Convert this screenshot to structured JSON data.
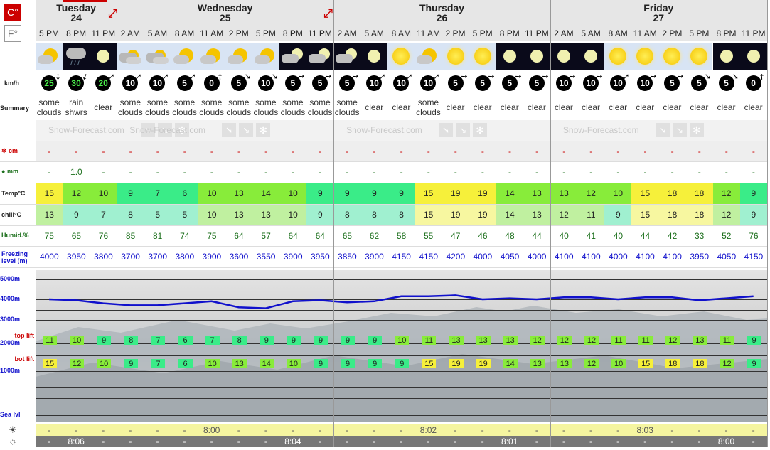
{
  "units": {
    "temp": "C°",
    "fahrenheit": "F°"
  },
  "days": [
    {
      "name": "Tuesday",
      "date": "24"
    },
    {
      "name": "Wednesday",
      "date": "25"
    },
    {
      "name": "Thursday",
      "date": "26"
    },
    {
      "name": "Friday",
      "date": "27"
    }
  ],
  "times": [
    "5 PM",
    "8 PM",
    "11 PM",
    "2 AM",
    "5 AM",
    "8 AM",
    "11 AM",
    "2 PM",
    "5 PM",
    "8 PM",
    "11 PM",
    "2 AM",
    "5 AM",
    "8 AM",
    "11 AM",
    "2 PM",
    "5 PM",
    "8 PM",
    "11 PM",
    "2 AM",
    "5 AM",
    "8 AM",
    "11 AM",
    "2 PM",
    "5 PM",
    "8 PM",
    "11 PM"
  ],
  "weather_icons": [
    "partly-cloudy-icon",
    "night-rain-icon",
    "night-clear-icon",
    "cloudy-icon",
    "cloudy-icon",
    "partly-cloudy-icon",
    "partly-cloudy-icon",
    "partly-cloudy-icon",
    "partly-cloudy-icon",
    "night-cloudy-icon",
    "night-cloudy-icon",
    "night-cloudy-icon",
    "night-clear-icon",
    "sun-icon",
    "partly-cloudy-icon",
    "sun-icon",
    "sun-icon",
    "night-clear-icon",
    "night-clear-icon",
    "night-clear-icon",
    "night-clear-icon",
    "sun-icon",
    "sun-icon",
    "sun-icon",
    "sun-icon",
    "night-clear-icon",
    "night-clear-icon"
  ],
  "wind_label": "km/h",
  "wind": [
    25,
    30,
    20,
    10,
    10,
    5,
    0,
    5,
    10,
    5,
    5,
    5,
    10,
    10,
    10,
    5,
    5,
    5,
    5,
    10,
    10,
    10,
    10,
    5,
    5,
    5,
    0
  ],
  "wind_dir": [
    180,
    200,
    45,
    45,
    45,
    45,
    0,
    135,
    135,
    90,
    90,
    90,
    45,
    45,
    45,
    90,
    90,
    90,
    90,
    90,
    90,
    45,
    90,
    90,
    135,
    135,
    0
  ],
  "summary_label": "Summary",
  "summary": [
    "some clouds",
    "rain shwrs",
    "clear",
    "some clouds",
    "some clouds",
    "some clouds",
    "some clouds",
    "some clouds",
    "some clouds",
    "some clouds",
    "some clouds",
    "some clouds",
    "clear",
    "clear",
    "some clouds",
    "clear",
    "clear",
    "clear",
    "clear",
    "clear",
    "clear",
    "clear",
    "clear",
    "clear",
    "clear",
    "clear",
    "clear"
  ],
  "brand": "Snow-Forecast.com",
  "snow_label": "cm",
  "snow": [
    "-",
    "-",
    "-",
    "-",
    "-",
    "-",
    "-",
    "-",
    "-",
    "-",
    "-",
    "-",
    "-",
    "-",
    "-",
    "-",
    "-",
    "-",
    "-",
    "-",
    "-",
    "-",
    "-",
    "-",
    "-",
    "-",
    "-"
  ],
  "rain_label": "mm",
  "rain": [
    "-",
    "1.0",
    "-",
    "-",
    "-",
    "-",
    "-",
    "-",
    "-",
    "-",
    "-",
    "-",
    "-",
    "-",
    "-",
    "-",
    "-",
    "-",
    "-",
    "-",
    "-",
    "-",
    "-",
    "-",
    "-",
    "-",
    "-"
  ],
  "temp_label": "Temp°C",
  "temp": [
    15,
    12,
    10,
    9,
    7,
    6,
    10,
    13,
    14,
    10,
    9,
    9,
    9,
    9,
    15,
    19,
    19,
    14,
    13,
    13,
    12,
    10,
    15,
    18,
    18,
    12,
    9
  ],
  "chill_label": "chill°C",
  "chill": [
    13,
    9,
    7,
    8,
    5,
    5,
    10,
    13,
    13,
    10,
    9,
    8,
    8,
    8,
    15,
    19,
    19,
    14,
    13,
    12,
    11,
    9,
    15,
    18,
    18,
    12,
    9
  ],
  "humid_label": "Humid.%",
  "humid": [
    75,
    65,
    76,
    85,
    81,
    74,
    75,
    64,
    57,
    64,
    64,
    65,
    62,
    58,
    55,
    47,
    46,
    48,
    44,
    40,
    41,
    40,
    44,
    42,
    33,
    52,
    76
  ],
  "freeze_label": "Freezing level (m)",
  "freeze": [
    4000,
    3950,
    3800,
    3700,
    3700,
    3800,
    3900,
    3600,
    3550,
    3900,
    3950,
    3850,
    3900,
    4150,
    4150,
    4200,
    4000,
    4050,
    4000,
    4100,
    4100,
    4000,
    4100,
    4100,
    3950,
    4050,
    4150
  ],
  "alt_labels": [
    "5000m",
    "4000m",
    "3000m",
    "2000m",
    "1000m",
    "Sea lvl"
  ],
  "top_lift_label": "top lift",
  "top_lift": [
    11,
    10,
    9,
    8,
    7,
    6,
    7,
    8,
    9,
    9,
    9,
    9,
    9,
    10,
    11,
    13,
    13,
    13,
    12,
    12,
    12,
    11,
    11,
    12,
    13,
    11,
    9
  ],
  "bot_lift_label": "bot lift",
  "bot_lift": [
    15,
    12,
    10,
    9,
    7,
    6,
    10,
    13,
    14,
    10,
    9,
    9,
    9,
    9,
    15,
    19,
    19,
    14,
    13,
    13,
    12,
    10,
    15,
    18,
    18,
    12,
    9
  ],
  "sunrise": [
    "-",
    "-",
    "-",
    "-",
    "-",
    "-",
    "8:00",
    "-",
    "-",
    "-",
    "-",
    "-",
    "-",
    "-",
    "8:02",
    "-",
    "-",
    "-",
    "-",
    "-",
    "-",
    "-",
    "8:03",
    "-",
    "-",
    "-",
    "-"
  ],
  "sunset": [
    "-",
    "8:06",
    "-",
    "-",
    "-",
    "-",
    "-",
    "-",
    "-",
    "8:04",
    "-",
    "-",
    "-",
    "-",
    "-",
    "-",
    "-",
    "8:01",
    "-",
    "-",
    "-",
    "-",
    "-",
    "-",
    "-",
    "8:00",
    "-"
  ],
  "colors": {
    "accent": "#cc0000",
    "freeze_line": "#1010cc",
    "sun_row": "#f5f5a0",
    "sunset_row": "#777777"
  }
}
